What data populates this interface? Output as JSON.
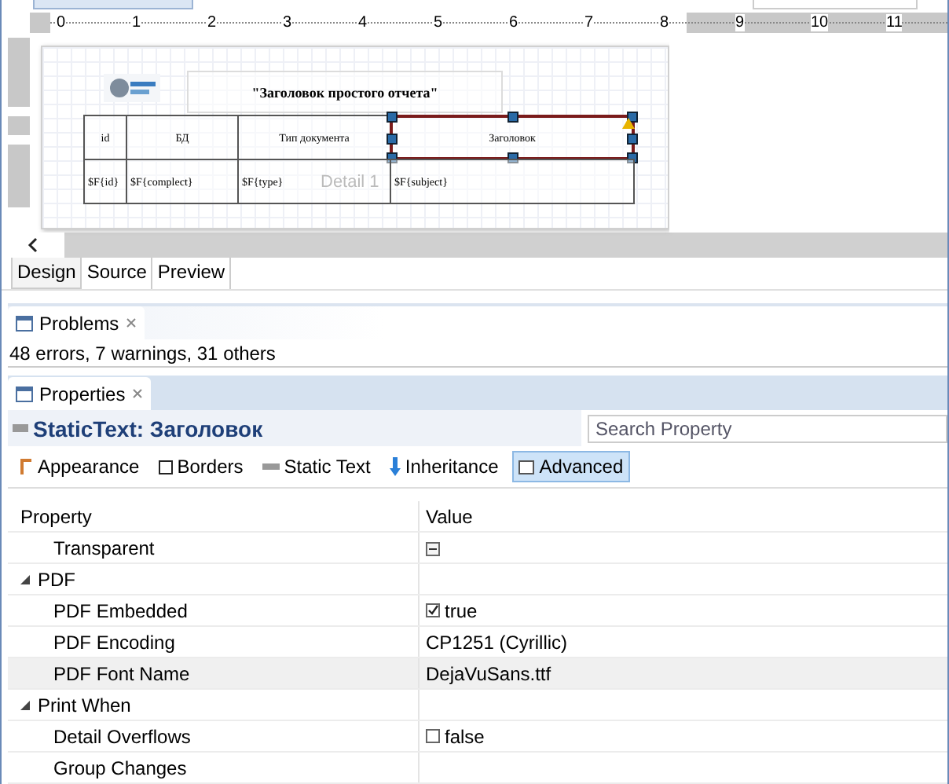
{
  "designer": {
    "ruler": [
      "0",
      "1",
      "2",
      "3",
      "4",
      "5",
      "6",
      "7",
      "8",
      "9",
      "10",
      "11"
    ],
    "report": {
      "title": "\"Заголовок простого отчета\"",
      "band": "Detail 1",
      "columns": [
        {
          "header": "id",
          "field": "$F{id}",
          "selected": false
        },
        {
          "header": "БД",
          "field": "$F{complect}",
          "selected": false
        },
        {
          "header": "Тип документа",
          "field": "$F{type}",
          "selected": false
        },
        {
          "header": "Заголовок",
          "field": "$F{subject}",
          "selected": true
        }
      ]
    },
    "tabs": [
      {
        "label": "Design",
        "selected": true
      },
      {
        "label": "Source",
        "selected": false
      },
      {
        "label": "Preview",
        "selected": false
      }
    ]
  },
  "problems": {
    "title": "Problems",
    "summary": "48 errors, 7 warnings, 31 others"
  },
  "properties": {
    "title": "Properties",
    "element": "StaticText: Заголовок",
    "search": {
      "placeholder": "Search Property"
    },
    "sections": [
      {
        "label": "Appearance",
        "selected": false
      },
      {
        "label": "Borders",
        "selected": false
      },
      {
        "label": "Static Text",
        "selected": false
      },
      {
        "label": "Inheritance",
        "selected": false
      },
      {
        "label": "Advanced",
        "selected": true
      }
    ],
    "columns": [
      "Property",
      "Value"
    ],
    "rows": [
      {
        "kind": "mixed",
        "name": "Transparent",
        "selected": false
      },
      {
        "kind": "group",
        "name": "PDF",
        "expanded": true,
        "selected": false
      },
      {
        "kind": "check",
        "name": "PDF Embedded",
        "checked": true,
        "value": "true",
        "selected": false
      },
      {
        "kind": "text",
        "name": "PDF Encoding",
        "value": "CP1251 (Cyrillic)",
        "selected": false
      },
      {
        "kind": "text",
        "name": "PDF Font Name",
        "value": "DejaVuSans.ttf",
        "selected": true
      },
      {
        "kind": "group",
        "name": "Print When",
        "expanded": true,
        "selected": false
      },
      {
        "kind": "check",
        "name": "Detail Overflows",
        "checked": false,
        "value": "false",
        "selected": false
      },
      {
        "kind": "text",
        "name": "Group Changes",
        "selected": false
      }
    ]
  }
}
